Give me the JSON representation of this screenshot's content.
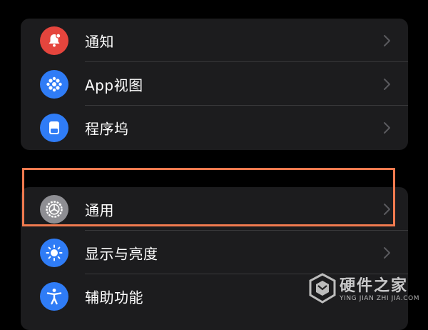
{
  "groups": [
    {
      "items": [
        {
          "label": "通知",
          "icon": "bell-icon",
          "color": "#e5453d"
        },
        {
          "label": "App视图",
          "icon": "app-grid-icon",
          "color": "#2f7cf6"
        },
        {
          "label": "程序坞",
          "icon": "dock-icon",
          "color": "#2f7cf6"
        }
      ]
    },
    {
      "items": [
        {
          "label": "通用",
          "icon": "gear-icon",
          "color": "#8e8e93"
        },
        {
          "label": "显示与亮度",
          "icon": "sun-icon",
          "color": "#2f7cf6"
        },
        {
          "label": "辅助功能",
          "icon": "accessibility-icon",
          "color": "#2f7cf6"
        }
      ]
    }
  ],
  "highlight": {
    "target": "通用",
    "color": "#f07a4f"
  },
  "watermark": {
    "title": "硬件之家",
    "subtitle": "YING JIAN ZHI JIA.COM"
  }
}
